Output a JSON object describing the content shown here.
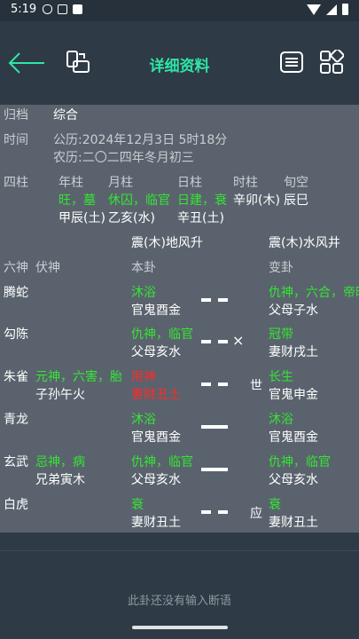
{
  "status": {
    "time": "5:19"
  },
  "header": {
    "title": "详细资料",
    "icons": [
      "back-arrow-icon",
      "switch-icon",
      "list-icon",
      "grid-icon"
    ]
  },
  "info": {
    "gui_dang_label": "归档",
    "gui_dang_value": "综合",
    "shi_jian_label": "时间",
    "gongli": "公历:2024年12月3日  5时18分",
    "nongli": "农历:二〇二四年冬月初三",
    "sizhu_label": "四柱",
    "pillars": [
      {
        "head": "年柱",
        "state": "旺，墓",
        "ganzhi": "甲辰(土)"
      },
      {
        "head": "月柱",
        "state": "休囚，临官",
        "ganzhi": "乙亥(水)"
      },
      {
        "head": "日柱",
        "state": "日建，衰",
        "ganzhi": "辛丑(土)"
      },
      {
        "head": "时柱",
        "state": "",
        "ganzhi": "辛卯(木)"
      },
      {
        "head": "旬空",
        "state": "",
        "ganzhi": "辰巳"
      }
    ]
  },
  "gua": {
    "ben_name": "震(木)地风升",
    "bian_name": "震(木)水风井",
    "col_liushen": "六神",
    "col_fushen": "伏神",
    "col_bengua": "本卦",
    "col_biangua": "变卦",
    "lines": [
      {
        "liushen": "腾蛇",
        "fu_state": "",
        "fu_name": "",
        "ben_state": "沐浴",
        "ben_name": "官鬼酉金",
        "mark": "",
        "shiying": "",
        "bian_state": "仇神，六合，帝旺",
        "bian_name": "父母子水"
      },
      {
        "liushen": "勾陈",
        "fu_state": "",
        "fu_name": "",
        "ben_state": "仇神，临官",
        "ben_name": "父母亥水",
        "mark": "×",
        "shiying": "",
        "bian_state": "冠带",
        "bian_name": "妻财戌土"
      },
      {
        "liushen": "朱雀",
        "fu_state": "元神，六害，胎",
        "fu_name": "子孙午火",
        "ben_state": "用神",
        "ben_name": "妻财丑土",
        "mark": "",
        "shiying": "世",
        "bian_state": "长生",
        "bian_name": "官鬼申金"
      },
      {
        "liushen": "青龙",
        "fu_state": "",
        "fu_name": "",
        "ben_state": "沐浴",
        "ben_name": "官鬼酉金",
        "mark": "",
        "shiying": "",
        "bian_state": "沐浴",
        "bian_name": "官鬼酉金"
      },
      {
        "liushen": "玄武",
        "fu_state": "忌神，病",
        "fu_name": "兄弟寅木",
        "ben_state": "仇神，临官",
        "ben_name": "父母亥水",
        "mark": "",
        "shiying": "",
        "bian_state": "仇神，临官",
        "bian_name": "父母亥水"
      },
      {
        "liushen": "白虎",
        "fu_state": "",
        "fu_name": "",
        "ben_state": "衰",
        "ben_name": "妻财丑土",
        "mark": "",
        "shiying": "应",
        "bian_state": "衰",
        "bian_name": "妻财丑土"
      }
    ]
  },
  "footer": {
    "hint": "此卦还没有输入断语"
  },
  "colors": {
    "accent": "#2ee6a6",
    "good": "#33e633",
    "bad": "#ff2a2a",
    "panel": "#5a636d",
    "bar": "#2e3a45"
  }
}
